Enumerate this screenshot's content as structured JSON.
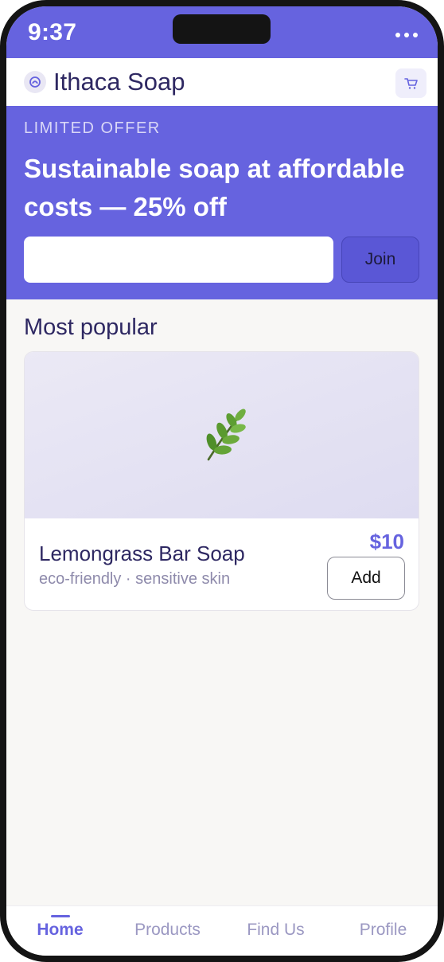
{
  "status_bar": {
    "time": "9:37"
  },
  "header": {
    "title": "Ithaca Soap",
    "logo_icon": "smile-circle-icon",
    "cart_icon": "cart-icon"
  },
  "promo": {
    "eyebrow": "LIMITED OFFER",
    "headline": "Sustainable soap at affordable costs — 25% off",
    "email_placeholder": "",
    "join_label": "Join"
  },
  "section": {
    "title": "Most popular"
  },
  "products": [
    {
      "image_icon": "herb-leaf-icon",
      "name": "Lemongrass Bar Soap",
      "tags": "eco-friendly · sensitive skin",
      "price": "$10",
      "add_label": "Add"
    }
  ],
  "nav": {
    "tabs": [
      {
        "label": "Home",
        "active": true
      },
      {
        "label": "Products",
        "active": false
      },
      {
        "label": "Find Us",
        "active": false
      },
      {
        "label": "Profile",
        "active": false
      }
    ]
  },
  "colors": {
    "accent": "#6663df",
    "heading": "#2e2862",
    "muted": "#8e8aab",
    "background": "#f8f7f5"
  }
}
